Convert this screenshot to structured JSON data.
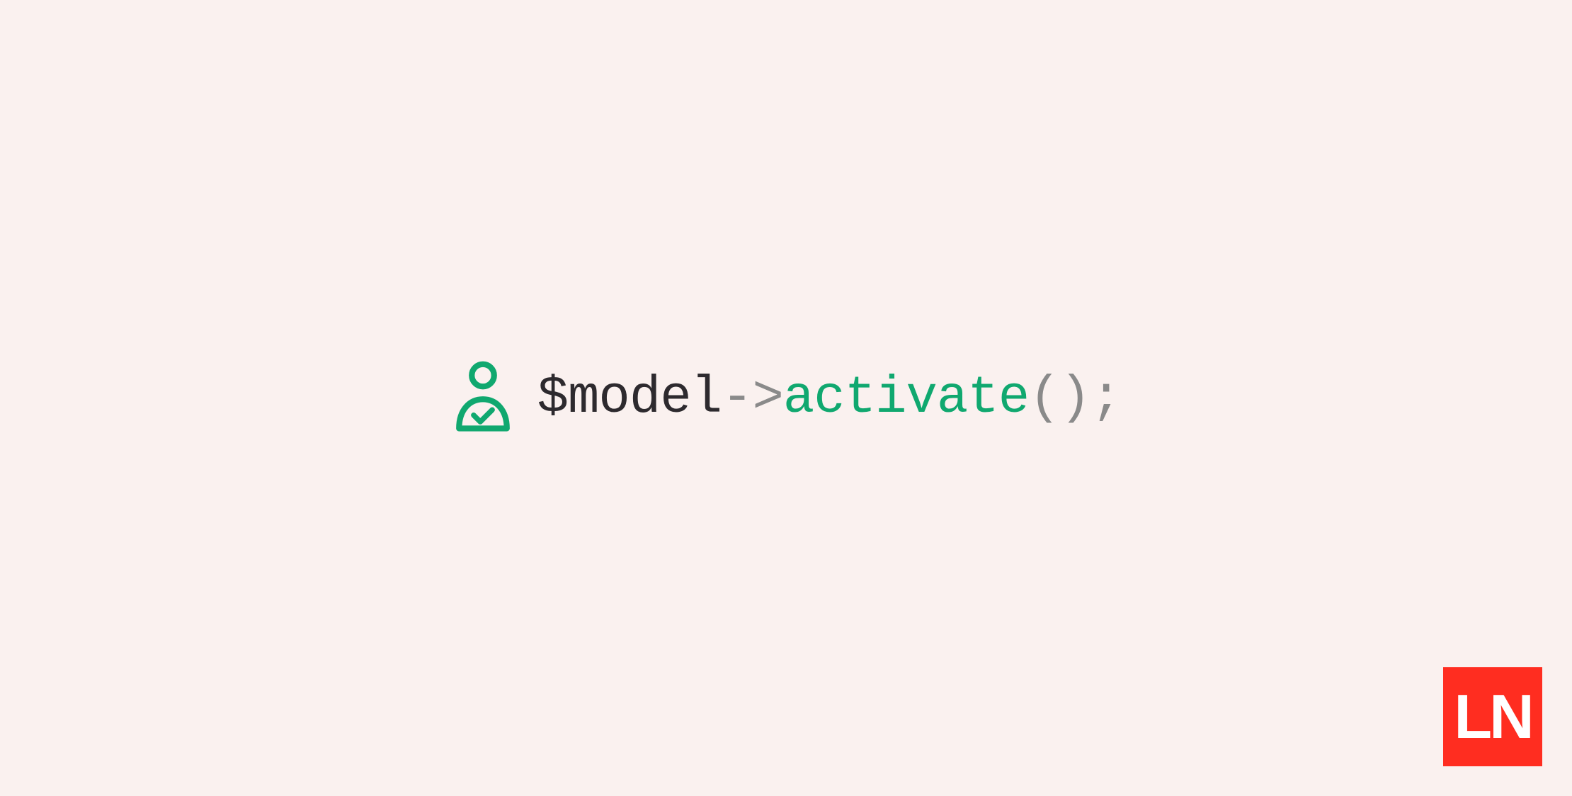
{
  "code": {
    "variable": "$model",
    "arrow": "->",
    "method": "activate",
    "parens": "()",
    "semicolon": ";"
  },
  "logo": {
    "text": "LN"
  },
  "colors": {
    "background": "#faf1ef",
    "accent_green": "#10a86f",
    "brand_red": "#ff2d20",
    "text_dark": "#2d2a2e",
    "text_muted": "#8a8a8a"
  },
  "icons": {
    "user_check": "user-check-icon"
  }
}
